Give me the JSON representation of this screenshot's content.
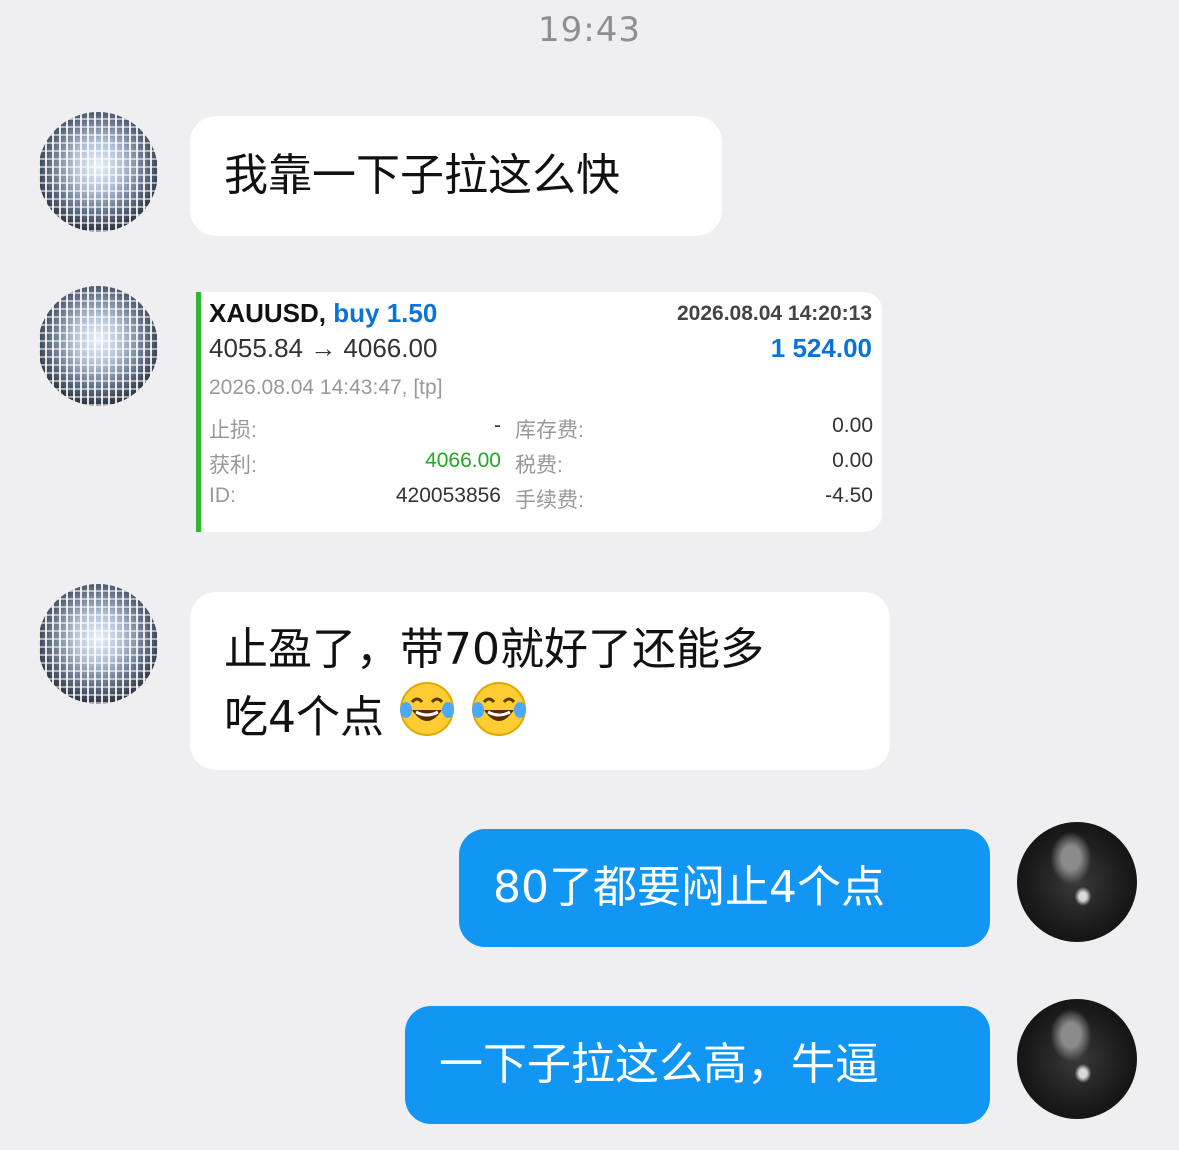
{
  "status": {
    "time": "19:43"
  },
  "messages": {
    "m1": {
      "text": "我靠一下子拉这么快"
    },
    "trade": {
      "symbol": "XAUUSD,",
      "side": "buy 1.50",
      "open_time": "2026.08.04 14:20:13",
      "prices": "4055.84 → 4066.00",
      "profit": "1 524.00",
      "close_time": "2026.08.04 14:43:47, [tp]",
      "stop_loss_label": "止损:",
      "stop_loss_value": "-",
      "take_profit_label": "获利:",
      "take_profit_value": "4066.00",
      "id_label": "ID:",
      "id_value": "420053856",
      "swap_label": "库存费:",
      "swap_value": "0.00",
      "tax_label": "税费:",
      "tax_value": "0.00",
      "commission_label": "手续费:",
      "commission_value": "-4.50"
    },
    "m2": {
      "line1": "止盈了，带70就好了还能多",
      "line2": "吃4个点"
    },
    "m3": {
      "text": "80了都要闷止4个点"
    },
    "m4": {
      "text": "一下子拉这么高，牛逼"
    }
  },
  "colors": {
    "background": "#efeff1",
    "outgoing_bubble": "#1296f3",
    "incoming_bubble": "#ffffff",
    "trade_accent": "#2eb82e",
    "profit_blue": "#0a74d6"
  },
  "icons": {
    "emoji": "laughing-tears-emoji"
  }
}
